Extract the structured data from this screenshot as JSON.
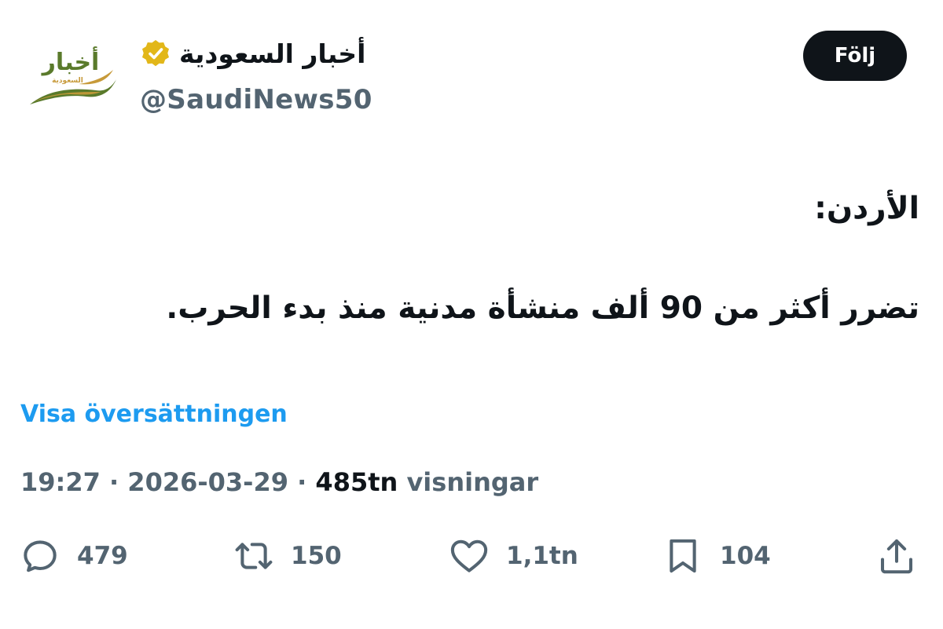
{
  "author": {
    "display_name": "أخبار السعودية",
    "handle": "@SaudiNews50",
    "verified": true,
    "avatar_logo_text": "أخبار السعودية",
    "verified_color": "#e2b719"
  },
  "follow_button": {
    "label": "Följ"
  },
  "tweet": {
    "lines": [
      "الأردن:",
      "تضرر أكثر من 90 ألف منشأة مدنية منذ بدء الحرب."
    ]
  },
  "translate_link": "Visa översättningen",
  "meta": {
    "time": "19:27",
    "separator": " · ",
    "date": "2026-03-29",
    "views_count": "485tn",
    "views_label": " visningar"
  },
  "actions": {
    "reply": {
      "icon": "reply-icon",
      "count": "479"
    },
    "retweet": {
      "icon": "retweet-icon",
      "count": "150"
    },
    "like": {
      "icon": "heart-icon",
      "count": "1,1tn"
    },
    "bookmark": {
      "icon": "bookmark-icon",
      "count": "104"
    },
    "share": {
      "icon": "share-icon"
    }
  },
  "colors": {
    "text_primary": "#0f1419",
    "text_secondary": "#536471",
    "link": "#1d9bf0",
    "follow_bg": "#0f1419",
    "logo_green": "#5a7a2b",
    "logo_gold": "#c79a3a"
  }
}
